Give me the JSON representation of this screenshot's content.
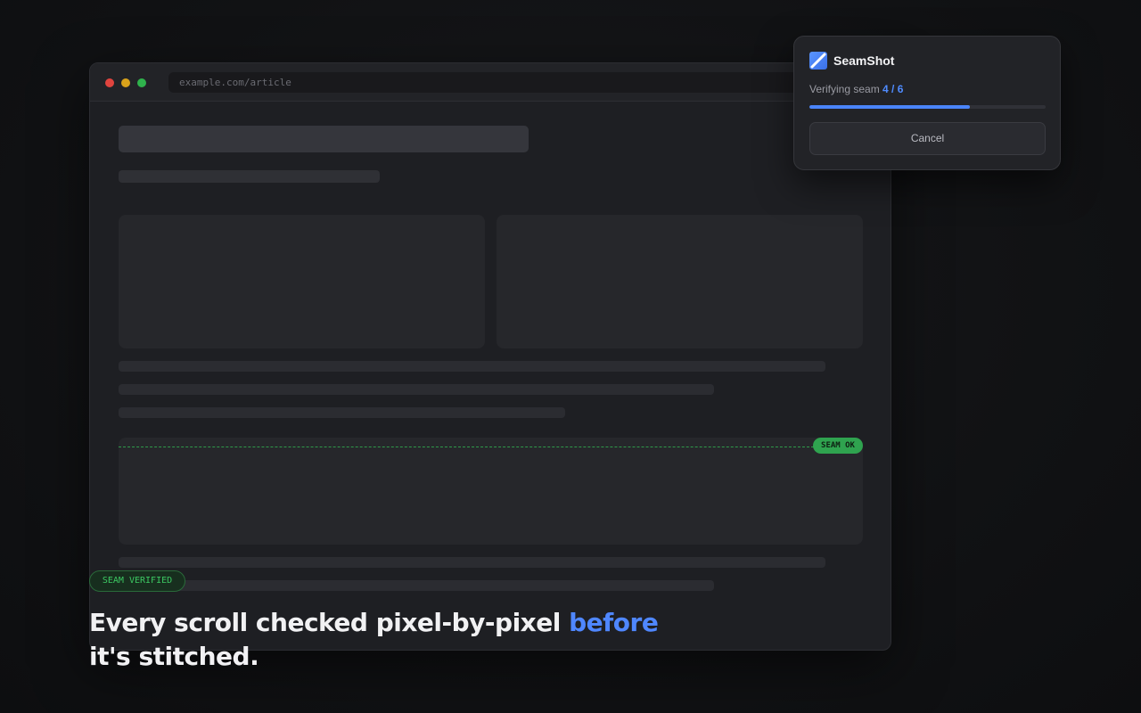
{
  "browser": {
    "url": "example.com/article"
  },
  "seam_marker": {
    "label": "SEAM OK",
    "color": "#2fa34f"
  },
  "popup": {
    "app_name": "SeamShot",
    "logo_icon": "seamshot-logo-icon",
    "status_prefix": "Verifying seam",
    "status_count": "4 / 6",
    "progress": 0.68,
    "accent_color": "#4a84f8",
    "cancel_label": "Cancel"
  },
  "badge": {
    "label": "SEAM VERIFIED",
    "color": "#3cc862"
  },
  "headline": {
    "part1": "Every scroll checked pixel-by-pixel",
    "accent": "before",
    "part2": "it's stitched."
  }
}
